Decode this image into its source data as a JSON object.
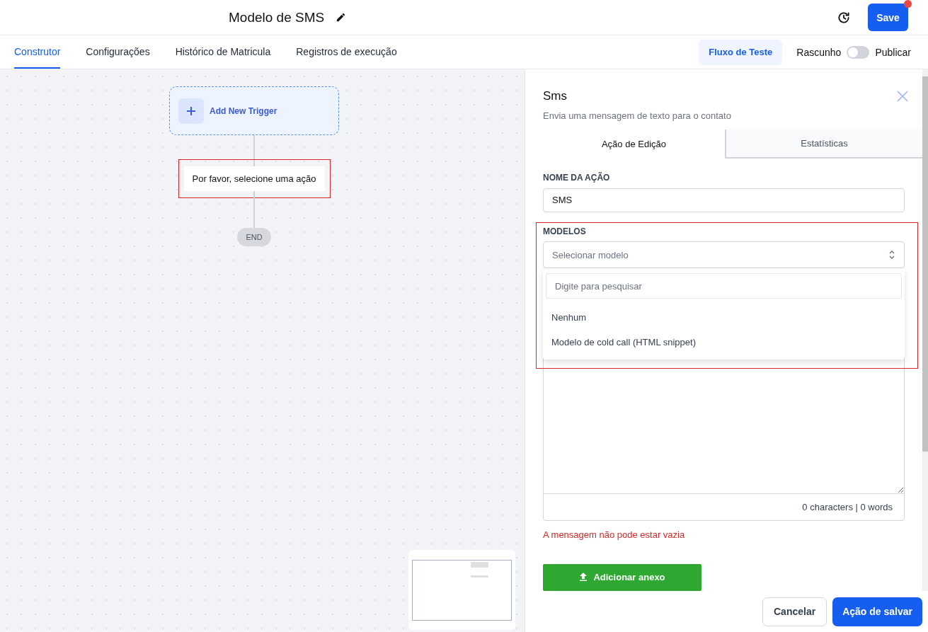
{
  "header": {
    "title": "Modelo de SMS",
    "save": "Save",
    "save_badge": true
  },
  "tabs": [
    {
      "label": "Construtor",
      "selected": true
    },
    {
      "label": "Configurações",
      "selected": false
    },
    {
      "label": "Histórico de Matricula",
      "selected": false
    },
    {
      "label": "Registros de execução",
      "selected": false
    }
  ],
  "test_flow": "Fluxo de Teste",
  "publish_toggle": {
    "off_label": "Rascunho",
    "on_label": "Publicar",
    "on": false
  },
  "canvas": {
    "trigger": "Add New Trigger",
    "action_placeholder": "Por favor, selecione uma ação",
    "action_highlighted": true,
    "end": "END"
  },
  "panel": {
    "title": "Sms",
    "subtitle": "Envia uma mensagem de texto para o contato",
    "tabs": [
      {
        "label": "Ação de Edição",
        "selected": true
      },
      {
        "label": "Estatísticas",
        "selected": false
      }
    ],
    "name_label": "NOME DA AÇÃO",
    "name_value": "SMS",
    "templates_label": "MODELOS",
    "templates_placeholder": "Selecionar modelo",
    "templates_highlighted": true,
    "dropdown": {
      "open": true,
      "search_placeholder": "Digite para pesquisar",
      "options": [
        {
          "label": "Nenhum",
          "selected": false
        },
        {
          "label": "Modelo de cold call (HTML snippet)",
          "selected": false
        }
      ]
    },
    "counter": "0 characters | 0 words",
    "error": "A mensagem não pode estar vazia",
    "attach": "Adicionar anexo",
    "cancel": "Cancelar",
    "save": "Ação de salvar"
  }
}
